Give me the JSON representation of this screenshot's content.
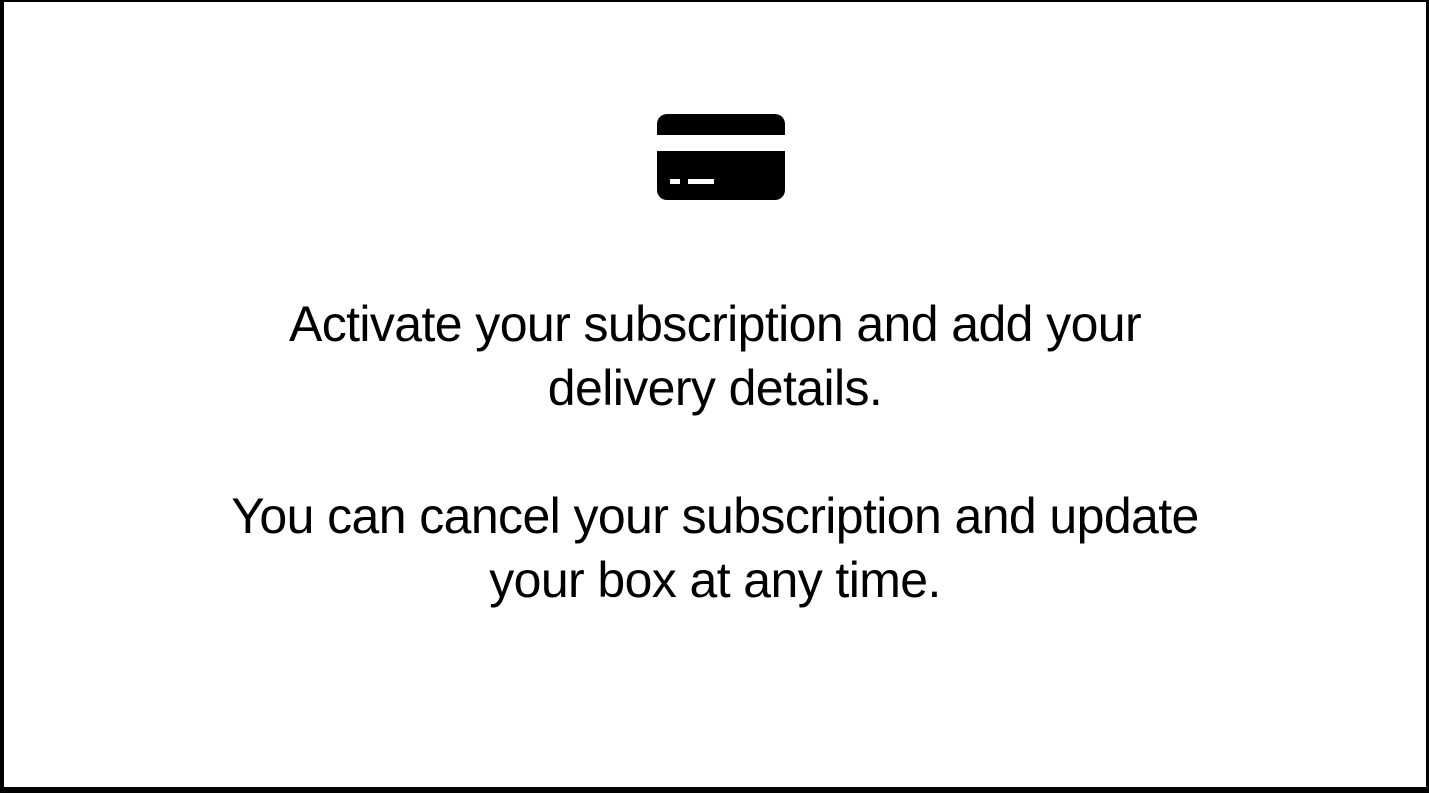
{
  "icon": "credit-card-icon",
  "messages": [
    {
      "lines": [
        "Activate your subscription and add your",
        "delivery details."
      ]
    },
    {
      "lines": [
        "You can cancel your subscription and update",
        "your box at any time."
      ]
    }
  ],
  "colors": {
    "text": "#000000",
    "background": "#ffffff",
    "icon": "#000000"
  }
}
